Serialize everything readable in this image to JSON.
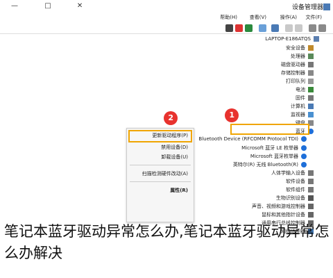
{
  "window": {
    "title": "设备管理器"
  },
  "menubar": {
    "items": [
      "文件(F)",
      "操作(A)",
      "查看(V)",
      "帮助(H)"
    ]
  },
  "tree": {
    "root": "LAPTOP-E186ATQS",
    "items": [
      {
        "label": "安全设备"
      },
      {
        "label": "处理器"
      },
      {
        "label": "磁盘驱动器"
      },
      {
        "label": "存储控制器"
      },
      {
        "label": "打印队列"
      },
      {
        "label": "电池"
      },
      {
        "label": "固件"
      },
      {
        "label": "计算机"
      },
      {
        "label": "监视器"
      },
      {
        "label": "键盘"
      },
      {
        "label": "蓝牙"
      },
      {
        "label": "Bluetooth Device (RFCOMM Protocol TDI)"
      },
      {
        "label": "Microsoft 蓝牙 LE 枚举器"
      },
      {
        "label": "Microsoft 蓝牙枚举器"
      },
      {
        "label": "英特尔(R) 无线 Bluetooth(R)"
      },
      {
        "label": "人体学输入设备"
      },
      {
        "label": "软件设备"
      },
      {
        "label": "软件组件"
      },
      {
        "label": "生物识别设备"
      },
      {
        "label": "声音、视频和游戏控制器"
      },
      {
        "label": "鼠标和其他指针设备"
      },
      {
        "label": "通用串行总线控制器"
      },
      {
        "label": "网络适配器"
      }
    ]
  },
  "context_menu": {
    "items": [
      "更新驱动程序(P)",
      "禁用设备(D)",
      "卸载设备(U)",
      "扫描检测硬件改动(A)",
      "属性(R)"
    ]
  },
  "badges": {
    "step1": "1",
    "step2": "2"
  },
  "caption": "笔记本蓝牙驱动异常怎么办,笔记本蓝牙驱动异常怎么办解决",
  "colors": {
    "highlight": "#f0a500",
    "badge": "#e8322e"
  }
}
